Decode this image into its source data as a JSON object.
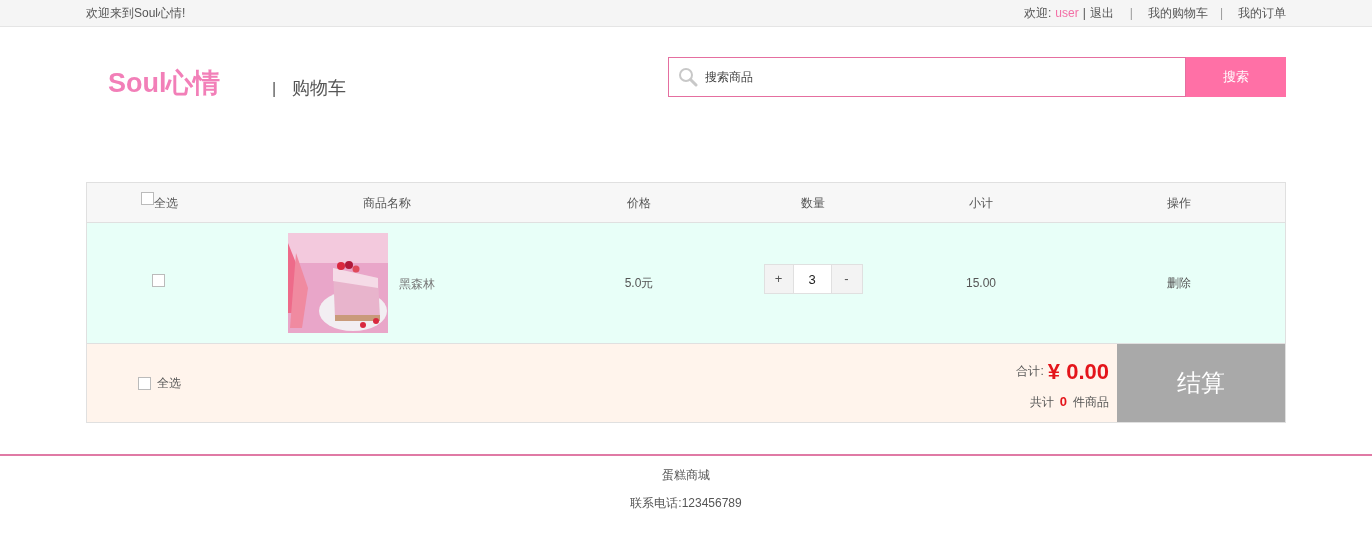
{
  "top_bar": {
    "welcome": "欢迎来到Soul心情!",
    "greeting": "欢迎:",
    "username": "user",
    "separator": "|",
    "logout": "退出",
    "links": [
      {
        "label": "我的购物车"
      },
      {
        "label": "我的订单"
      }
    ]
  },
  "header": {
    "logo": "Soul心情",
    "divider": "|",
    "page_title": "购物车",
    "search": {
      "placeholder": "搜索商品",
      "button": "搜索"
    }
  },
  "cart": {
    "select_all_header": {
      "label": "全选",
      "checked": false
    },
    "columns": [
      "商品名称",
      "价格",
      "数量",
      "小计",
      "操作"
    ],
    "rows": [
      {
        "checked": false,
        "name": "黑森林",
        "price": "5.0元",
        "plus": "+",
        "quantity": "3",
        "minus": "-",
        "subtotal": "15.00",
        "action": "删除"
      }
    ],
    "footer": {
      "select_all": {
        "label": "全选",
        "checked": false
      },
      "total_label": "合计:",
      "total": "¥ 0.00",
      "count_prefix": "共计",
      "count": "0",
      "count_suffix": "件商品",
      "checkout": "结算"
    }
  },
  "page_footer": {
    "name": "蛋糕商城",
    "contact": "联系电话:123456789"
  }
}
